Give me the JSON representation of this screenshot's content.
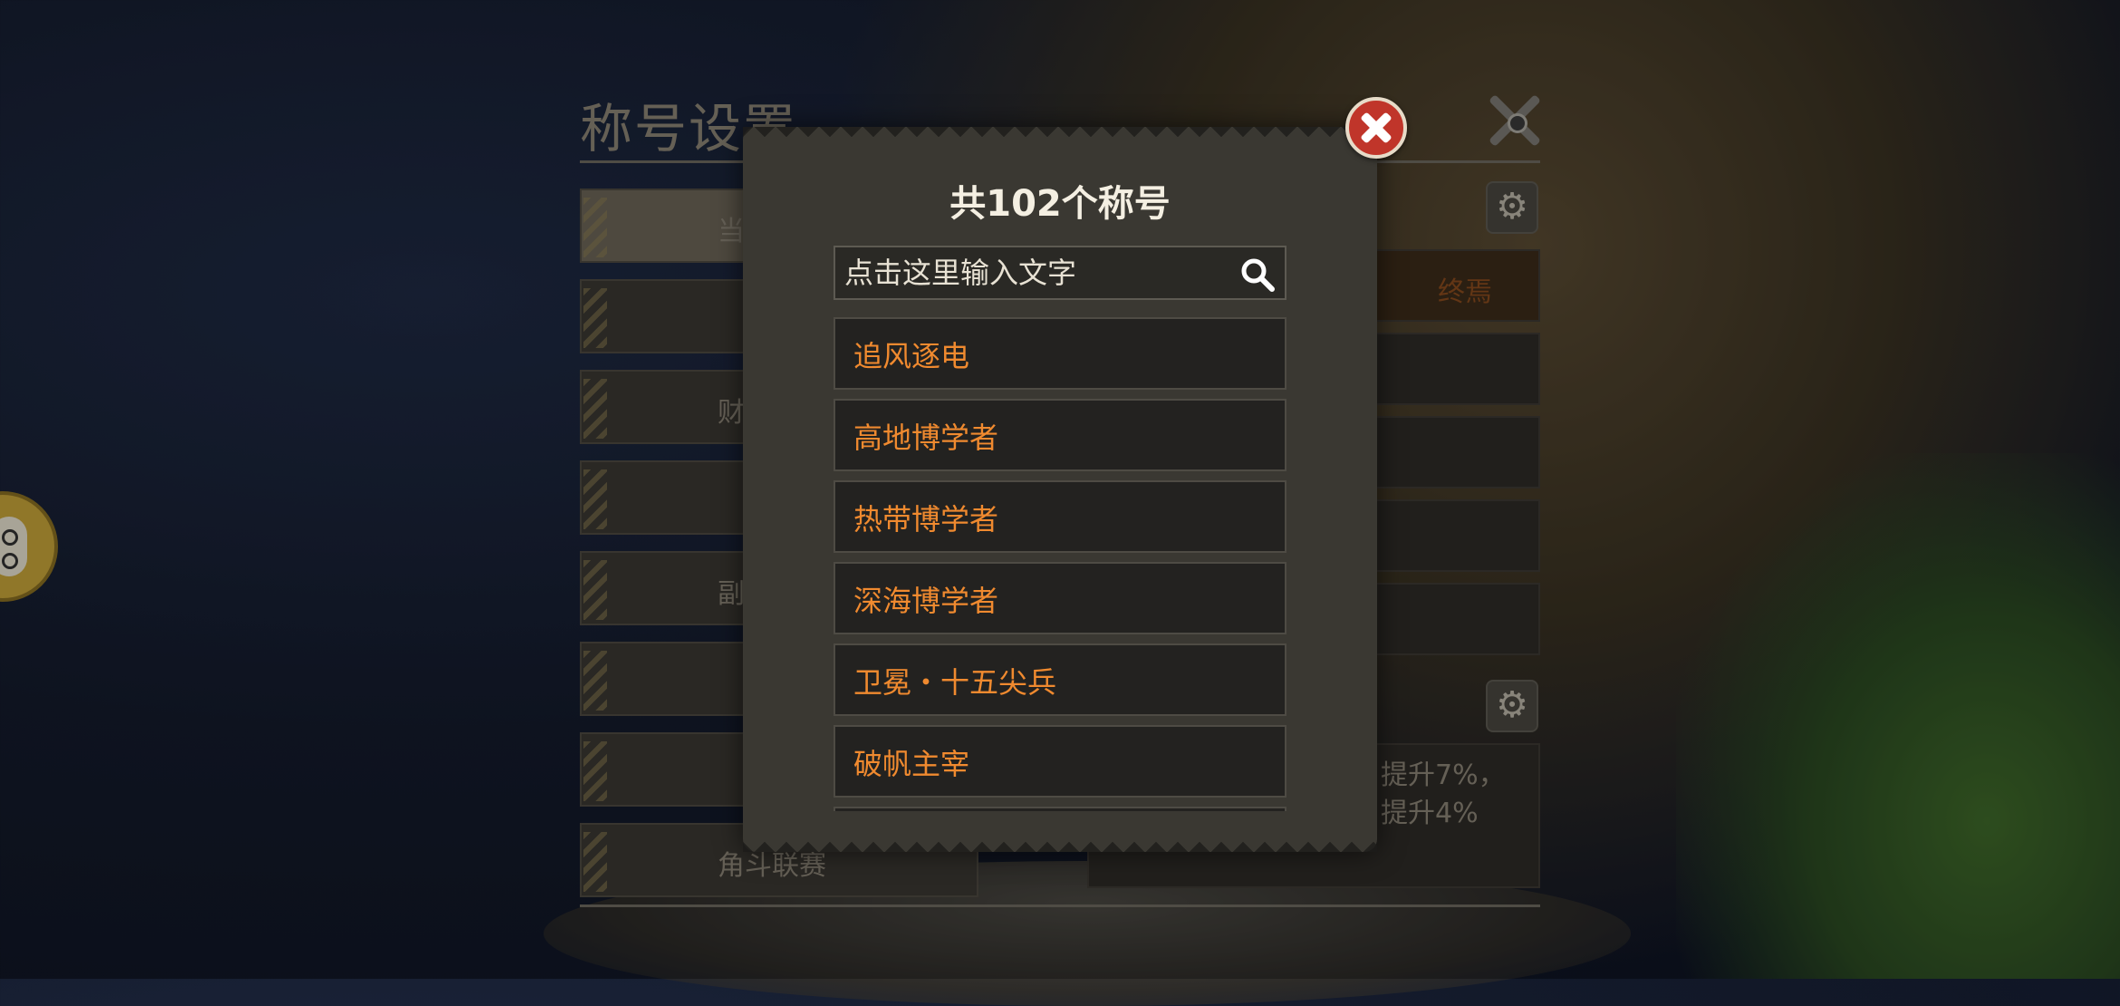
{
  "base_panel": {
    "title": "称号设置",
    "tabs": [
      {
        "label": "当前使用",
        "active": true
      },
      {
        "label": "",
        "active": false
      },
      {
        "label": "财富",
        "active": false
      },
      {
        "label": "",
        "active": false
      },
      {
        "label": "副本",
        "active": false
      },
      {
        "label": "",
        "active": false
      },
      {
        "label": "",
        "active": false
      },
      {
        "label": "角斗联赛",
        "active": false
      }
    ],
    "right_text_title": "终焉",
    "right_text_line1": "提升7%，",
    "right_text_line2": "提升4%"
  },
  "dialog": {
    "title": "共102个称号",
    "search_placeholder": "点击这里输入文字",
    "items": [
      "追风逐电",
      "高地博学者",
      "热带博学者",
      "深海博学者",
      "卫冕・十五尖兵",
      "破帆主宰"
    ]
  },
  "icons": {
    "search": "search-icon",
    "close": "close-icon",
    "settings": "gear-icon"
  },
  "colors": {
    "item_text": "#f08a2f",
    "close_button": "#c0352a",
    "title_text": "#f4efe2"
  }
}
